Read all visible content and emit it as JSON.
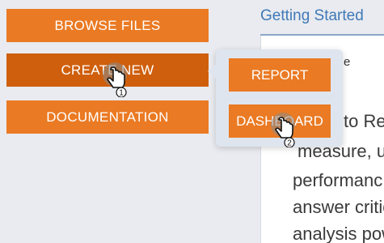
{
  "menu": {
    "browse_label": "BROWSE FILES",
    "create_label": "CREATE NEW",
    "docs_label": "DOCUMENTATION"
  },
  "submenu": {
    "report_label": "REPORT",
    "dashboard_label": "DASHBOARD"
  },
  "content": {
    "title": "Getting Started",
    "small_text": "e",
    "lines": [
      "to Re",
      "measure, un",
      "performanc",
      "answer critic",
      "analysis pow"
    ]
  },
  "cursors": {
    "first_step": "1",
    "second_step": "2"
  },
  "colors": {
    "accent": "#ea7a23",
    "accent_active": "#cf5f0c",
    "title_blue": "#3f79b7"
  },
  "icons": {
    "cursor": "pointing-hand-icon"
  }
}
